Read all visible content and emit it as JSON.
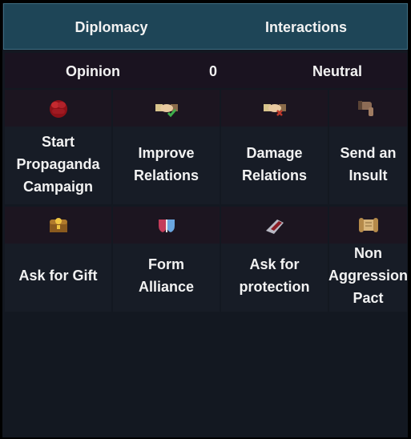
{
  "tabs": {
    "diplomacy": "Diplomacy",
    "interactions": "Interactions"
  },
  "opinion": {
    "label": "Opinion",
    "value": "0",
    "status": "Neutral"
  },
  "actions": [
    {
      "label": "Start\nPropaganda\nCampaign",
      "icon": "fist-icon"
    },
    {
      "label": "Improve\nRelations",
      "icon": "handshake-icon"
    },
    {
      "label": "Damage\nRelations",
      "icon": "handshake-icon"
    },
    {
      "label": "Send an\nInsult",
      "icon": "thumbs-down-icon"
    },
    {
      "label": "Ask for Gift",
      "icon": "treasure-chest-icon"
    },
    {
      "label": "Form\nAlliance",
      "icon": "shields-icon"
    },
    {
      "label": "Ask for\nprotection",
      "icon": "gauntlet-icon"
    },
    {
      "label": "Non\nAggression\nPact",
      "icon": "scroll-icon"
    }
  ]
}
